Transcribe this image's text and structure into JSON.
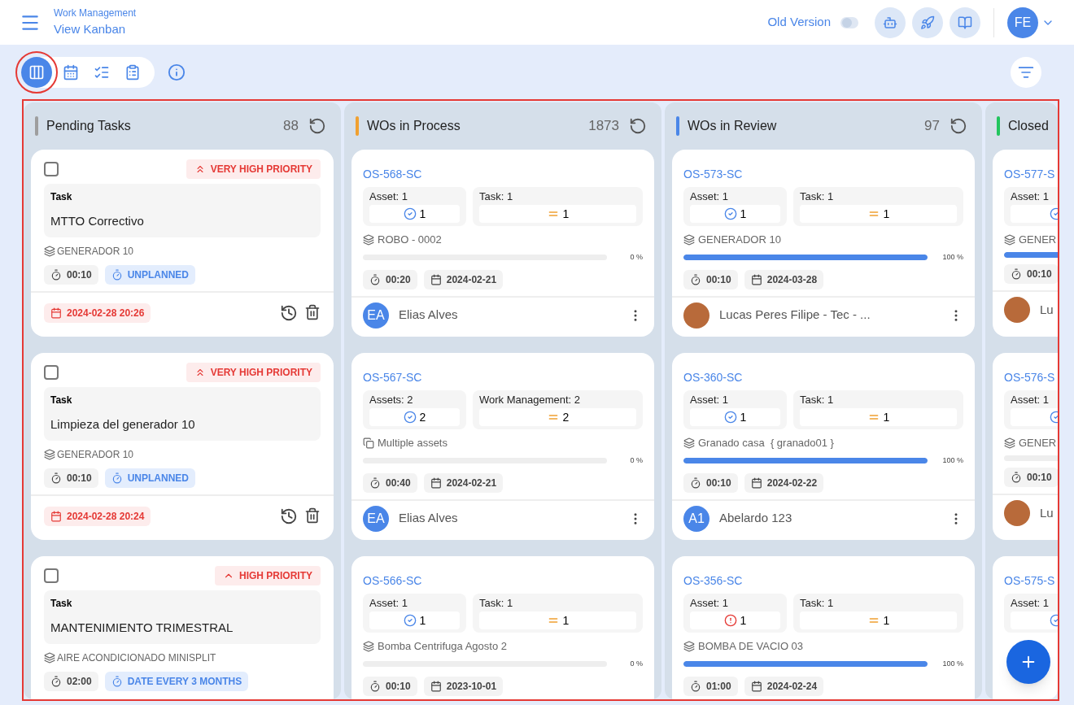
{
  "header": {
    "breadcrumb": "Work Management",
    "title": "View Kanban",
    "old_version": {
      "label": "Old Version",
      "on": false
    },
    "user_initials": "FE"
  },
  "view_tabs": [
    {
      "kind": "kanban",
      "selected": true
    },
    {
      "kind": "calendar",
      "selected": false
    },
    {
      "kind": "checklist",
      "selected": false
    },
    {
      "kind": "clipboard",
      "selected": false
    }
  ],
  "columns": [
    {
      "title": "Pending Tasks",
      "count": "88",
      "color": "#9e9e9e",
      "cards": [
        {
          "kind": "task",
          "checked": false,
          "priority": {
            "kind": "very_high",
            "text": "VERY HIGH PRIORITY"
          },
          "label": "Task",
          "name": "MTTO Correctivo",
          "asset": "GENERADOR 10",
          "duration": "00:10",
          "plan": "UNPLANNED",
          "date": "2024-02-28 20:26"
        },
        {
          "kind": "task",
          "checked": false,
          "priority": {
            "kind": "very_high",
            "text": "VERY HIGH PRIORITY"
          },
          "label": "Task",
          "name": "Limpieza del generador 10",
          "asset": "GENERADOR 10",
          "duration": "00:10",
          "plan": "UNPLANNED",
          "date": "2024-02-28 20:24"
        },
        {
          "kind": "task",
          "checked": false,
          "priority": {
            "kind": "high",
            "text": "HIGH PRIORITY"
          },
          "label": "Task",
          "name": "MANTENIMIENTO TRIMESTRAL",
          "asset": "AIRE ACONDICIONADO MINISPLIT",
          "duration": "02:00",
          "plan": "DATE EVERY 3 MONTHS"
        }
      ]
    },
    {
      "title": "WOs in Process",
      "count": "1873",
      "color": "#f0a030",
      "cards": [
        {
          "kind": "wo",
          "id": "OS-568-SC",
          "assets": {
            "label": "Asset: 1",
            "kind": "ok",
            "value": "1"
          },
          "tasks": {
            "label": "Task: 1",
            "value": "1"
          },
          "asset": {
            "kind": "single",
            "name": "ROBO - 0002"
          },
          "level": 0,
          "percent": "0 %",
          "duration": "00:20",
          "date": "2024-02-21",
          "assignee": {
            "kind": "initials",
            "initials": "EA",
            "name": "Elias Alves"
          }
        },
        {
          "kind": "wo",
          "id": "OS-567-SC",
          "assets": {
            "label": "Assets: 2",
            "kind": "ok",
            "value": "2"
          },
          "tasks": {
            "label": "Work Management: 2",
            "value": "2"
          },
          "asset": {
            "kind": "multiple",
            "name": "Multiple assets"
          },
          "level": 0,
          "percent": "0 %",
          "duration": "00:40",
          "date": "2024-02-21",
          "assignee": {
            "kind": "initials",
            "initials": "EA",
            "name": "Elias Alves"
          }
        },
        {
          "kind": "wo",
          "id": "OS-566-SC",
          "assets": {
            "label": "Asset: 1",
            "kind": "ok",
            "value": "1"
          },
          "tasks": {
            "label": "Task: 1",
            "value": "1"
          },
          "asset": {
            "kind": "single",
            "name": "Bomba Centrifuga Agosto 2"
          },
          "level": 0,
          "percent": "0 %",
          "duration": "00:10",
          "date": "2023-10-01"
        }
      ]
    },
    {
      "title": "WOs in Review",
      "count": "97",
      "color": "#4a86e8",
      "cards": [
        {
          "kind": "wo",
          "id": "OS-573-SC",
          "assets": {
            "label": "Asset: 1",
            "kind": "ok",
            "value": "1"
          },
          "tasks": {
            "label": "Task: 1",
            "value": "1"
          },
          "asset": {
            "kind": "single",
            "name": "GENERADOR 10"
          },
          "level": 1,
          "percent": "100 %",
          "duration": "00:10",
          "date": "2024-03-28",
          "assignee": {
            "kind": "photo",
            "name": "Lucas Peres Filipe - Tec - ..."
          }
        },
        {
          "kind": "wo",
          "id": "OS-360-SC",
          "assets": {
            "label": "Asset: 1",
            "kind": "ok",
            "value": "1"
          },
          "tasks": {
            "label": "Task: 1",
            "value": "1"
          },
          "asset": {
            "kind": "single",
            "name": "Granado casa  { granado01 }"
          },
          "level": 1,
          "percent": "100 %",
          "duration": "00:10",
          "date": "2024-02-22",
          "assignee": {
            "kind": "initials",
            "initials": "A1",
            "name": "Abelardo 123"
          }
        },
        {
          "kind": "wo",
          "id": "OS-356-SC",
          "assets": {
            "label": "Asset: 1",
            "kind": "alert",
            "value": "1"
          },
          "tasks": {
            "label": "Task: 1",
            "value": "1"
          },
          "asset": {
            "kind": "single",
            "name": "BOMBA DE VACIO 03"
          },
          "level": 1,
          "percent": "100 %",
          "duration": "01:00",
          "date": "2024-02-24"
        }
      ]
    },
    {
      "title": "Closed",
      "color": "#22c55e",
      "cards": [
        {
          "kind": "wo_cut",
          "id": "OS-577-S",
          "assets": {
            "label": "Asset: 1",
            "kind": "ok"
          },
          "asset": {
            "kind": "single",
            "name": "GENER"
          },
          "level": 1,
          "duration": "00:10",
          "assignee": {
            "kind": "photo",
            "name": "Lu"
          }
        },
        {
          "kind": "wo_cut",
          "id": "OS-576-S",
          "assets": {
            "label": "Asset: 1",
            "kind": "ok"
          },
          "asset": {
            "kind": "single",
            "name": "GENER"
          },
          "level": 0,
          "duration": "00:10",
          "assignee": {
            "kind": "photo",
            "name": "Lu"
          }
        },
        {
          "kind": "wo_cut",
          "id": "OS-575-S",
          "assets": {
            "label": "Asset: 1",
            "kind": "ok"
          }
        }
      ]
    }
  ]
}
